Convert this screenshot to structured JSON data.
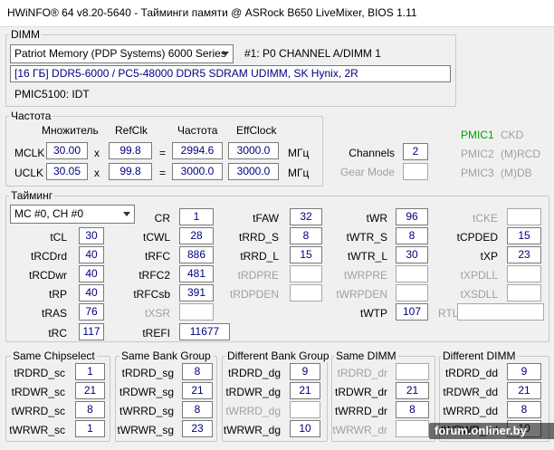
{
  "window": {
    "title": "HWiNFO® 64 v8.20-5640 - Тайминги памяти @ ASRock B650 LiveMixer, BIOS 1.11"
  },
  "dimm": {
    "group": "DIMM",
    "module_select": "Patriot Memory (PDP Systems) 6000 Series",
    "slot": "#1: P0 CHANNEL A/DIMM 1",
    "description": "[16 ГБ] DDR5-6000 / PC5-48000 DDR5 SDRAM UDIMM, SK Hynix, 2R",
    "pmic": "PMIC5100: IDT"
  },
  "freq": {
    "group": "Частота",
    "h_mult": "Множитель",
    "h_refclk": "RefClk",
    "h_freq": "Частота",
    "h_eff": "EffClock",
    "mclk_label": "MCLK",
    "mclk_mult": "30.00",
    "mclk_ref": "99.8",
    "mclk_freq": "2994.6",
    "mclk_eff": "3000.0",
    "uclk_label": "UCLK",
    "uclk_mult": "30.05",
    "uclk_ref": "99.8",
    "uclk_freq": "3000.0",
    "uclk_eff": "3000.0",
    "x": "x",
    "eq": "=",
    "unit": "МГц",
    "channels_label": "Channels",
    "channels": "2",
    "gear_label": "Gear Mode",
    "gear": "",
    "pmic1": "PMIC1",
    "pmic1_v": "CKD",
    "pmic2": "PMIC2",
    "pmic2_v": "(M)RCD",
    "pmic3": "PMIC3",
    "pmic3_v": "(M)DB"
  },
  "timing": {
    "group": "Тайминг",
    "channel_select": "MC #0, CH #0",
    "tCL": "30",
    "tRCDrd": "40",
    "tRCDwr": "40",
    "tRP": "40",
    "tRAS": "76",
    "tRC": "117",
    "CR": "1",
    "tCWL": "28",
    "tRFC": "886",
    "tRFC2": "481",
    "tRFCsb": "391",
    "tXSR": "",
    "tREFI": "11677",
    "tFAW": "32",
    "tRRD_S": "8",
    "tRRD_L": "15",
    "tRDPRE": "",
    "tRDPDEN": "",
    "tWR": "96",
    "tWTR_S": "8",
    "tWTR_L": "30",
    "tWRPRE": "",
    "tWRPDEN": "",
    "tWTP": "107",
    "tCKE": "",
    "tCPDED": "15",
    "tXP": "23",
    "tXPDLL": "",
    "tXSDLL": "",
    "RTL": ""
  },
  "same_chipselect": {
    "group": "Same Chipselect",
    "tRDRD_sc": "1",
    "tRDWR_sc": "21",
    "tWRRD_sc": "8",
    "tWRWR_sc": "1"
  },
  "same_bank_group": {
    "group": "Same Bank Group",
    "tRDRD_sg": "8",
    "tRDWR_sg": "21",
    "tWRRD_sg": "8",
    "tWRWR_sg": "23"
  },
  "diff_bank_group": {
    "group": "Different Bank Group",
    "tRDRD_dg": "9",
    "tRDWR_dg": "21",
    "tWRRD_dg": "",
    "tWRWR_dg": "10"
  },
  "same_dimm": {
    "group": "Same DIMM",
    "tRDRD_dr": "",
    "tRDWR_dr": "21",
    "tWRRD_dr": "8",
    "tWRWR_dr": ""
  },
  "diff_dimm": {
    "group": "Different DIMM",
    "tRDRD_dd": "9",
    "tRDWR_dd": "21",
    "tWRRD_dd": "8",
    "tWRWR_dd": "10"
  },
  "watermark": "forum.onliner.by"
}
